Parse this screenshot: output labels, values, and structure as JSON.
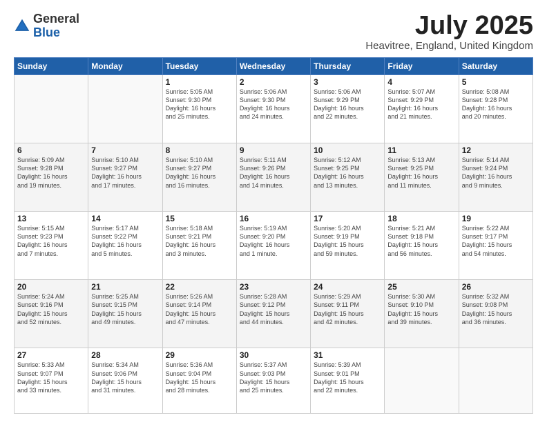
{
  "header": {
    "logo_general": "General",
    "logo_blue": "Blue",
    "month_title": "July 2025",
    "location": "Heavitree, England, United Kingdom"
  },
  "days_of_week": [
    "Sunday",
    "Monday",
    "Tuesday",
    "Wednesday",
    "Thursday",
    "Friday",
    "Saturday"
  ],
  "weeks": [
    [
      {
        "day": "",
        "info": ""
      },
      {
        "day": "",
        "info": ""
      },
      {
        "day": "1",
        "info": "Sunrise: 5:05 AM\nSunset: 9:30 PM\nDaylight: 16 hours\nand 25 minutes."
      },
      {
        "day": "2",
        "info": "Sunrise: 5:06 AM\nSunset: 9:30 PM\nDaylight: 16 hours\nand 24 minutes."
      },
      {
        "day": "3",
        "info": "Sunrise: 5:06 AM\nSunset: 9:29 PM\nDaylight: 16 hours\nand 22 minutes."
      },
      {
        "day": "4",
        "info": "Sunrise: 5:07 AM\nSunset: 9:29 PM\nDaylight: 16 hours\nand 21 minutes."
      },
      {
        "day": "5",
        "info": "Sunrise: 5:08 AM\nSunset: 9:28 PM\nDaylight: 16 hours\nand 20 minutes."
      }
    ],
    [
      {
        "day": "6",
        "info": "Sunrise: 5:09 AM\nSunset: 9:28 PM\nDaylight: 16 hours\nand 19 minutes."
      },
      {
        "day": "7",
        "info": "Sunrise: 5:10 AM\nSunset: 9:27 PM\nDaylight: 16 hours\nand 17 minutes."
      },
      {
        "day": "8",
        "info": "Sunrise: 5:10 AM\nSunset: 9:27 PM\nDaylight: 16 hours\nand 16 minutes."
      },
      {
        "day": "9",
        "info": "Sunrise: 5:11 AM\nSunset: 9:26 PM\nDaylight: 16 hours\nand 14 minutes."
      },
      {
        "day": "10",
        "info": "Sunrise: 5:12 AM\nSunset: 9:25 PM\nDaylight: 16 hours\nand 13 minutes."
      },
      {
        "day": "11",
        "info": "Sunrise: 5:13 AM\nSunset: 9:25 PM\nDaylight: 16 hours\nand 11 minutes."
      },
      {
        "day": "12",
        "info": "Sunrise: 5:14 AM\nSunset: 9:24 PM\nDaylight: 16 hours\nand 9 minutes."
      }
    ],
    [
      {
        "day": "13",
        "info": "Sunrise: 5:15 AM\nSunset: 9:23 PM\nDaylight: 16 hours\nand 7 minutes."
      },
      {
        "day": "14",
        "info": "Sunrise: 5:17 AM\nSunset: 9:22 PM\nDaylight: 16 hours\nand 5 minutes."
      },
      {
        "day": "15",
        "info": "Sunrise: 5:18 AM\nSunset: 9:21 PM\nDaylight: 16 hours\nand 3 minutes."
      },
      {
        "day": "16",
        "info": "Sunrise: 5:19 AM\nSunset: 9:20 PM\nDaylight: 16 hours\nand 1 minute."
      },
      {
        "day": "17",
        "info": "Sunrise: 5:20 AM\nSunset: 9:19 PM\nDaylight: 15 hours\nand 59 minutes."
      },
      {
        "day": "18",
        "info": "Sunrise: 5:21 AM\nSunset: 9:18 PM\nDaylight: 15 hours\nand 56 minutes."
      },
      {
        "day": "19",
        "info": "Sunrise: 5:22 AM\nSunset: 9:17 PM\nDaylight: 15 hours\nand 54 minutes."
      }
    ],
    [
      {
        "day": "20",
        "info": "Sunrise: 5:24 AM\nSunset: 9:16 PM\nDaylight: 15 hours\nand 52 minutes."
      },
      {
        "day": "21",
        "info": "Sunrise: 5:25 AM\nSunset: 9:15 PM\nDaylight: 15 hours\nand 49 minutes."
      },
      {
        "day": "22",
        "info": "Sunrise: 5:26 AM\nSunset: 9:14 PM\nDaylight: 15 hours\nand 47 minutes."
      },
      {
        "day": "23",
        "info": "Sunrise: 5:28 AM\nSunset: 9:12 PM\nDaylight: 15 hours\nand 44 minutes."
      },
      {
        "day": "24",
        "info": "Sunrise: 5:29 AM\nSunset: 9:11 PM\nDaylight: 15 hours\nand 42 minutes."
      },
      {
        "day": "25",
        "info": "Sunrise: 5:30 AM\nSunset: 9:10 PM\nDaylight: 15 hours\nand 39 minutes."
      },
      {
        "day": "26",
        "info": "Sunrise: 5:32 AM\nSunset: 9:08 PM\nDaylight: 15 hours\nand 36 minutes."
      }
    ],
    [
      {
        "day": "27",
        "info": "Sunrise: 5:33 AM\nSunset: 9:07 PM\nDaylight: 15 hours\nand 33 minutes."
      },
      {
        "day": "28",
        "info": "Sunrise: 5:34 AM\nSunset: 9:06 PM\nDaylight: 15 hours\nand 31 minutes."
      },
      {
        "day": "29",
        "info": "Sunrise: 5:36 AM\nSunset: 9:04 PM\nDaylight: 15 hours\nand 28 minutes."
      },
      {
        "day": "30",
        "info": "Sunrise: 5:37 AM\nSunset: 9:03 PM\nDaylight: 15 hours\nand 25 minutes."
      },
      {
        "day": "31",
        "info": "Sunrise: 5:39 AM\nSunset: 9:01 PM\nDaylight: 15 hours\nand 22 minutes."
      },
      {
        "day": "",
        "info": ""
      },
      {
        "day": "",
        "info": ""
      }
    ]
  ]
}
